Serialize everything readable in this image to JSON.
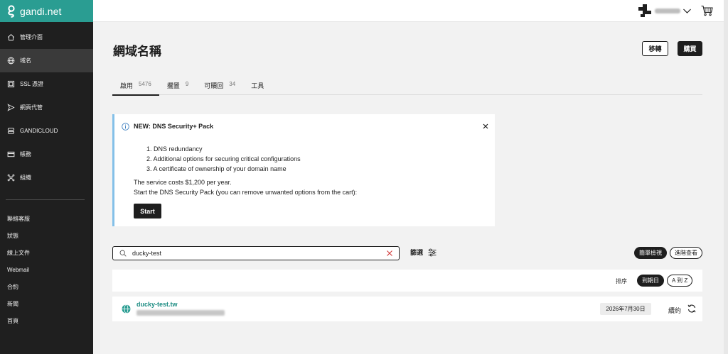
{
  "brand": {
    "name": "gandi.net",
    "color": "#2a9d92"
  },
  "sidebar": {
    "items": [
      {
        "label": "管理介面",
        "icon": "home-icon"
      },
      {
        "label": "域名",
        "icon": "globe-icon",
        "active": true
      },
      {
        "label": "SSL 憑證",
        "icon": "certificate-icon"
      },
      {
        "label": "網頁代管",
        "icon": "send-icon"
      },
      {
        "label": "GANDICLOUD",
        "icon": "cloud-server-icon"
      },
      {
        "label": "帳務",
        "icon": "credit-card-icon"
      },
      {
        "label": "組織",
        "icon": "organization-icon"
      }
    ],
    "links": [
      "聯絡客服",
      "狀態",
      "線上文件",
      "Webmail",
      "合約",
      "新聞",
      "首頁"
    ]
  },
  "header": {
    "title": "網域名稱",
    "transfer_label": "移轉",
    "buy_label": "購買"
  },
  "tabs": [
    {
      "label": "啟用",
      "count": "5476",
      "active": true
    },
    {
      "label": "擱置",
      "count": "9"
    },
    {
      "label": "可贖回",
      "count": "34"
    },
    {
      "label": "工具",
      "count": ""
    }
  ],
  "notice": {
    "title": "NEW: DNS Security+ Pack",
    "items": [
      "1. DNS redundancy",
      "2. Additional options for securing critical configurations",
      "3. A certificate of ownership of your domain name"
    ],
    "price_text": "The service costs $1,200 per year.",
    "cta_text": "Start the DNS Security Pack (you can remove unwanted options from the cart):",
    "button_label": "Start",
    "accent_color": "#84c0e8"
  },
  "search": {
    "value": "ducky-test",
    "placeholder": ""
  },
  "filter": {
    "label": "篩選"
  },
  "view": {
    "simple_label": "簡單檢視",
    "advanced_label": "進階查看"
  },
  "sort": {
    "label": "排序",
    "by_date_label": "到期日",
    "az_label": "A 到 Z"
  },
  "domains": [
    {
      "name": "ducky-test.tw",
      "expiry": "2026年7月30日",
      "renew_label": "續約"
    }
  ]
}
